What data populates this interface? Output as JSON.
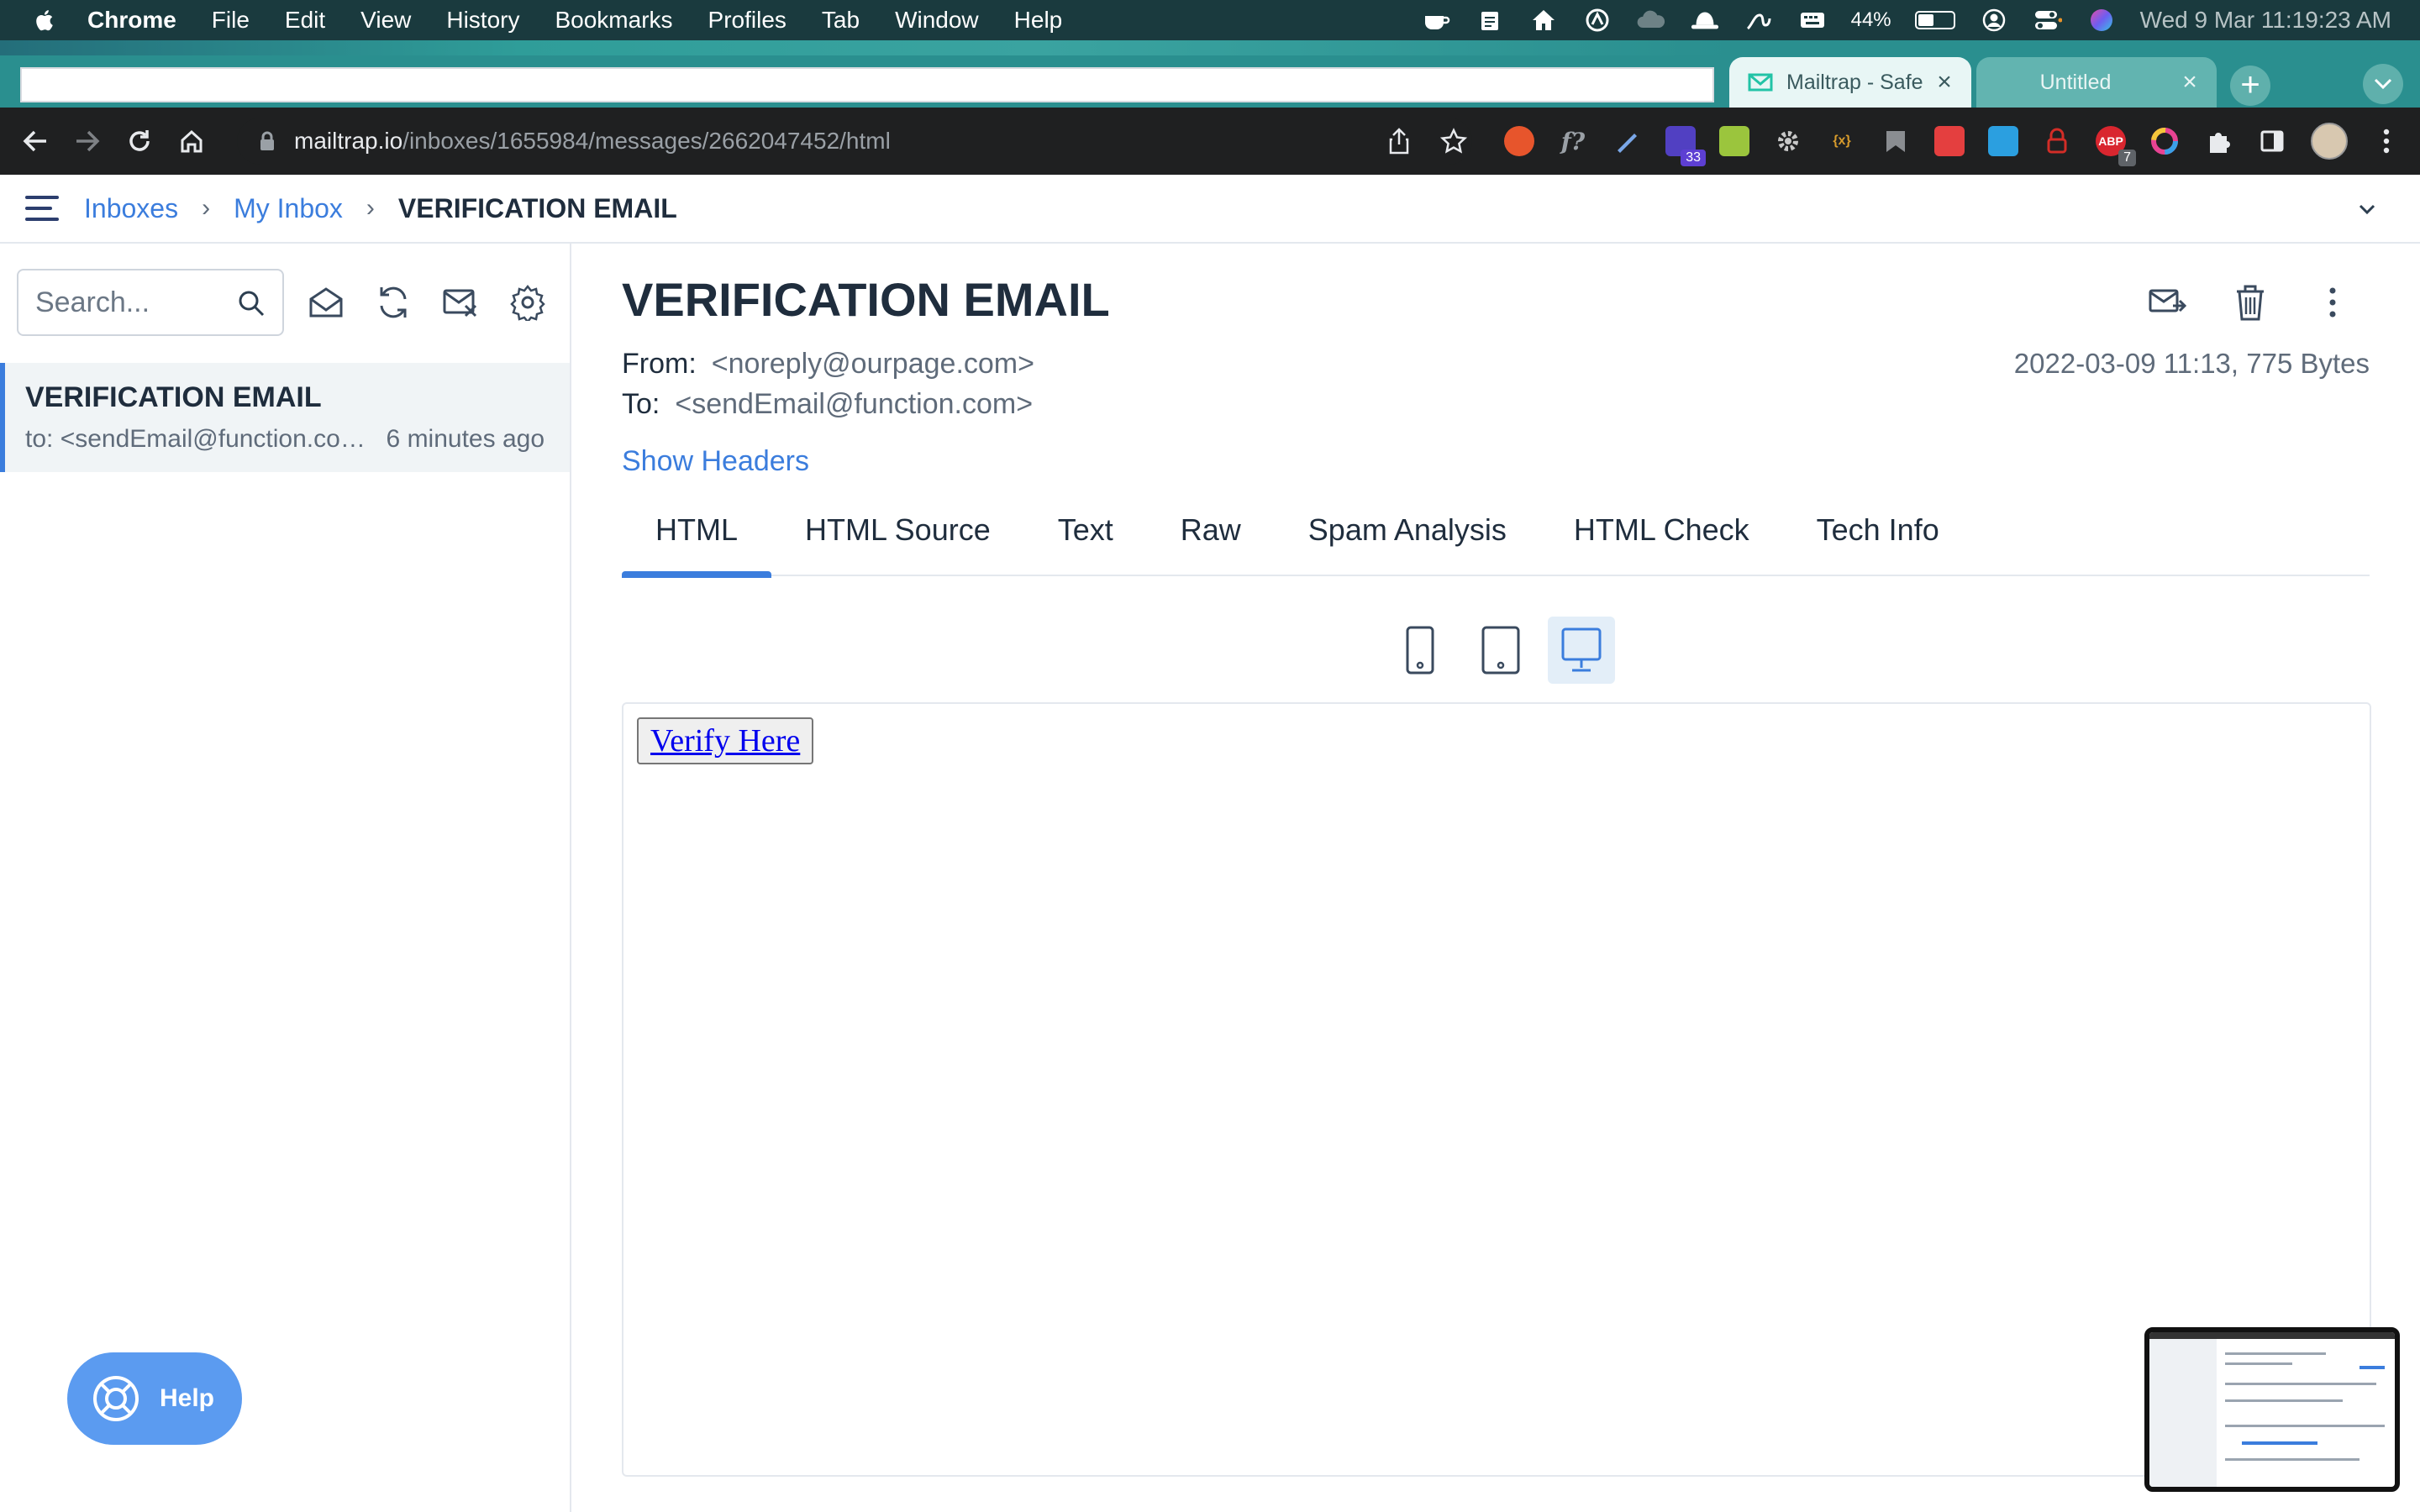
{
  "menubar": {
    "app_name": "Chrome",
    "menus": [
      "File",
      "Edit",
      "View",
      "History",
      "Bookmarks",
      "Profiles",
      "Tab",
      "Window",
      "Help"
    ],
    "battery_percent": "44%",
    "battery_level": 0.44,
    "clock": "Wed 9 Mar  11:19:23 AM"
  },
  "browser": {
    "tabs": [
      {
        "title": "Mailtrap - Safe Email Testing",
        "active": true
      },
      {
        "title": "Untitled",
        "active": false
      }
    ],
    "new_tab_label": "+",
    "url_host": "mailtrap.io",
    "url_path": "/inboxes/1655984/messages/2662047452/html",
    "extension_badges": {
      "extension_1": "33",
      "adblock": "7"
    }
  },
  "header": {
    "breadcrumb": [
      "Inboxes",
      "My Inbox",
      "VERIFICATION EMAIL"
    ]
  },
  "sidebar": {
    "search_placeholder": "Search...",
    "messages": [
      {
        "subject": "VERIFICATION EMAIL",
        "to": "to: <sendEmail@function.com>",
        "time": "6 minutes ago"
      }
    ],
    "help_label": "Help"
  },
  "email": {
    "title": "VERIFICATION EMAIL",
    "from_label": "From:",
    "from": "<noreply@ourpage.com>",
    "to_label": "To:",
    "to": "<sendEmail@function.com>",
    "date_size": "2022-03-09 11:13, 775 Bytes",
    "show_headers": "Show Headers",
    "tabs": [
      "HTML",
      "HTML Source",
      "Text",
      "Raw",
      "Spam Analysis",
      "HTML Check",
      "Tech Info"
    ],
    "active_tab": "HTML",
    "preview": {
      "button_label": "Verify Here"
    }
  }
}
